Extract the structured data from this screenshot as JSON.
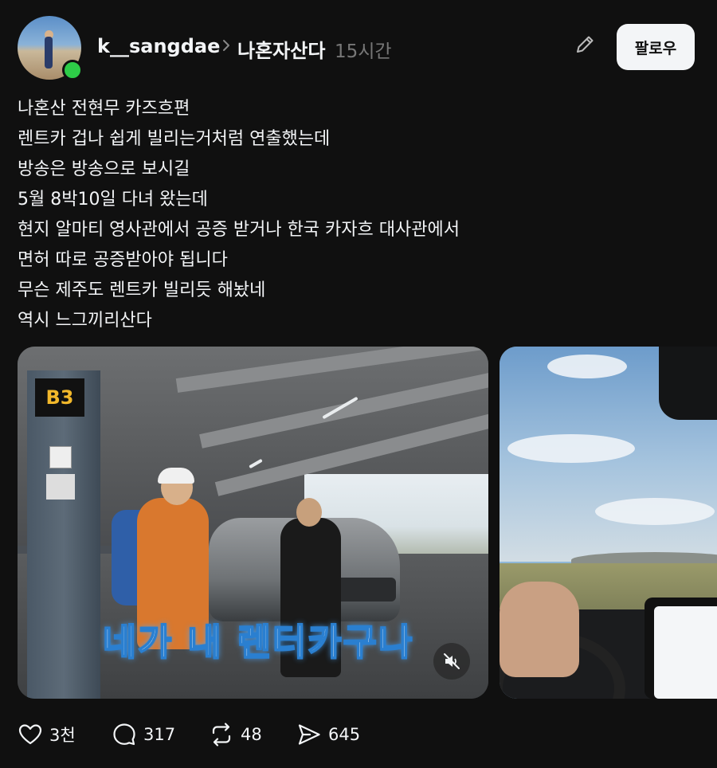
{
  "post": {
    "username": "k__sangdae",
    "community": "나혼자산다",
    "time": "15시간",
    "follow_label": "팔로우",
    "body_lines": [
      "나혼산 전현무 카즈흐편",
      "렌트카 겁나 쉽게 빌리는거처럼 연출했는데",
      "방송은 방송으로 보시길",
      "5월 8박10일 다녀 왔는데",
      "현지 알마티 영사관에서 공증 받거나 한국 카자흐 대사관에서",
      "면허 따로 공증받아야 됩니다",
      "무슨 제주도 렌트카 빌리듯 해놨네",
      "역시 느그끼리산다"
    ]
  },
  "media": {
    "video_caption": "네가 내 렌터카구나",
    "parking_sign": "B3",
    "muted": true
  },
  "actions": {
    "likes": "3천",
    "comments": "317",
    "reposts": "48",
    "shares": "645"
  },
  "colors": {
    "background": "#101010",
    "text": "#f3f5f7",
    "muted_text": "#777777",
    "online": "#2ecc48",
    "caption_glow": "#4aa8ff"
  },
  "icons": [
    "chevron-right-icon",
    "edit-icon",
    "mute-icon",
    "heart-icon",
    "comment-icon",
    "repost-icon",
    "share-icon"
  ]
}
